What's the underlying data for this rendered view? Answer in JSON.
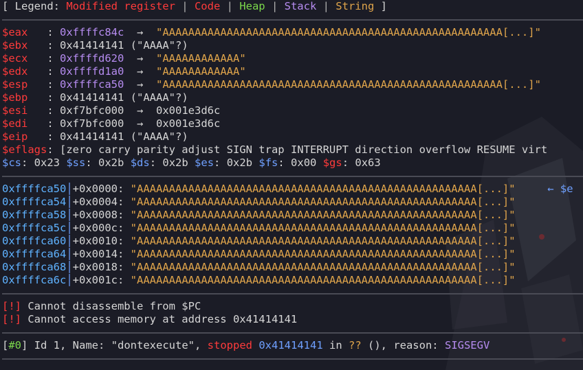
{
  "legend": {
    "open": "[ Legend: ",
    "modified": "Modified register",
    "sep": " | ",
    "code": "Code",
    "heap": "Heap",
    "stack": "Stack",
    "string": "String",
    "close": " ]"
  },
  "registers": {
    "eax": {
      "name": "$eax",
      "value": "0xffffc84c",
      "arrow": "  →  ",
      "deref": "\"AAAAAAAAAAAAAAAAAAAAAAAAAAAAAAAAAAAAAAAAAAAAAAAAAAAAA[...]\""
    },
    "ebx": {
      "name": "$ebx",
      "value": "0x41414141",
      "note": " (\"AAAA\"?)"
    },
    "ecx": {
      "name": "$ecx",
      "value": "0xffffd620",
      "arrow": "  →  ",
      "deref": "\"AAAAAAAAAAAA\""
    },
    "edx": {
      "name": "$edx",
      "value": "0xffffd1a0",
      "arrow": "  →  ",
      "deref": "\"AAAAAAAAAAAA\""
    },
    "esp": {
      "name": "$esp",
      "value": "0xffffca50",
      "arrow": "  →  ",
      "deref": "\"AAAAAAAAAAAAAAAAAAAAAAAAAAAAAAAAAAAAAAAAAAAAAAAAAAAAA[...]\""
    },
    "ebp": {
      "name": "$ebp",
      "value": "0x41414141",
      "note": " (\"AAAA\"?)"
    },
    "esi": {
      "name": "$esi",
      "value": "0xf7bfc000",
      "arrow": "  →  ",
      "deref": "0x001e3d6c"
    },
    "edi": {
      "name": "$edi",
      "value": "0xf7bfc000",
      "arrow": "  →  ",
      "deref": "0x001e3d6c"
    },
    "eip": {
      "name": "$eip",
      "value": "0x41414141",
      "note": " (\"AAAA\"?)"
    },
    "eflags": {
      "name": "$eflags",
      "value": "[zero carry parity adjust SIGN trap INTERRUPT direction overflow RESUME virt"
    }
  },
  "segments": [
    {
      "name": "$cs",
      "value": "0x23"
    },
    {
      "name": "$ss",
      "value": "0x2b"
    },
    {
      "name": "$ds",
      "value": "0x2b"
    },
    {
      "name": "$es",
      "value": "0x2b"
    },
    {
      "name": "$fs",
      "value": "0x00"
    },
    {
      "name": "$gs",
      "value": "0x63"
    }
  ],
  "stack": [
    {
      "addr": "0xffffca50",
      "offset": "+0x0000: ",
      "value": "\"AAAAAAAAAAAAAAAAAAAAAAAAAAAAAAAAAAAAAAAAAAAAAAAAAAAAA[...]\"",
      "marker": "     ← $e"
    },
    {
      "addr": "0xffffca54",
      "offset": "+0x0004: ",
      "value": "\"AAAAAAAAAAAAAAAAAAAAAAAAAAAAAAAAAAAAAAAAAAAAAAAAAAAAA[...]\""
    },
    {
      "addr": "0xffffca58",
      "offset": "+0x0008: ",
      "value": "\"AAAAAAAAAAAAAAAAAAAAAAAAAAAAAAAAAAAAAAAAAAAAAAAAAAAAA[...]\""
    },
    {
      "addr": "0xffffca5c",
      "offset": "+0x000c: ",
      "value": "\"AAAAAAAAAAAAAAAAAAAAAAAAAAAAAAAAAAAAAAAAAAAAAAAAAAAAA[...]\""
    },
    {
      "addr": "0xffffca60",
      "offset": "+0x0010: ",
      "value": "\"AAAAAAAAAAAAAAAAAAAAAAAAAAAAAAAAAAAAAAAAAAAAAAAAAAAAA[...]\""
    },
    {
      "addr": "0xffffca64",
      "offset": "+0x0014: ",
      "value": "\"AAAAAAAAAAAAAAAAAAAAAAAAAAAAAAAAAAAAAAAAAAAAAAAAAAAAA[...]\""
    },
    {
      "addr": "0xffffca68",
      "offset": "+0x0018: ",
      "value": "\"AAAAAAAAAAAAAAAAAAAAAAAAAAAAAAAAAAAAAAAAAAAAAAAAAAAAA[...]\""
    },
    {
      "addr": "0xffffca6c",
      "offset": "+0x001c: ",
      "value": "\"AAAAAAAAAAAAAAAAAAAAAAAAAAAAAAAAAAAAAAAAAAAAAAAAAAAAA[...]\""
    }
  ],
  "code": {
    "err1_tag": "[!]",
    "err1_text": " Cannot disassemble from $PC",
    "err2_tag": "[!]",
    "err2_text": " Cannot access memory at address 0x41414141"
  },
  "threads": {
    "open": "[",
    "id": "#0",
    "close": "]",
    "text1": " Id 1, Name: \"dontexecute\", ",
    "stopped": "stopped",
    "space1": " ",
    "addr": "0x41414141",
    "in": " in ",
    "func": "??",
    "text2": " (), reason: ",
    "reason": "SIGSEGV"
  },
  "colors": {
    "background": "#1b1c26",
    "modified": "#ff3b3b",
    "code": "#ff3b3b",
    "heap": "#7bd84b",
    "stack": "#b68cf0",
    "string": "#e0a54b",
    "register_value": "#b68cf0"
  }
}
